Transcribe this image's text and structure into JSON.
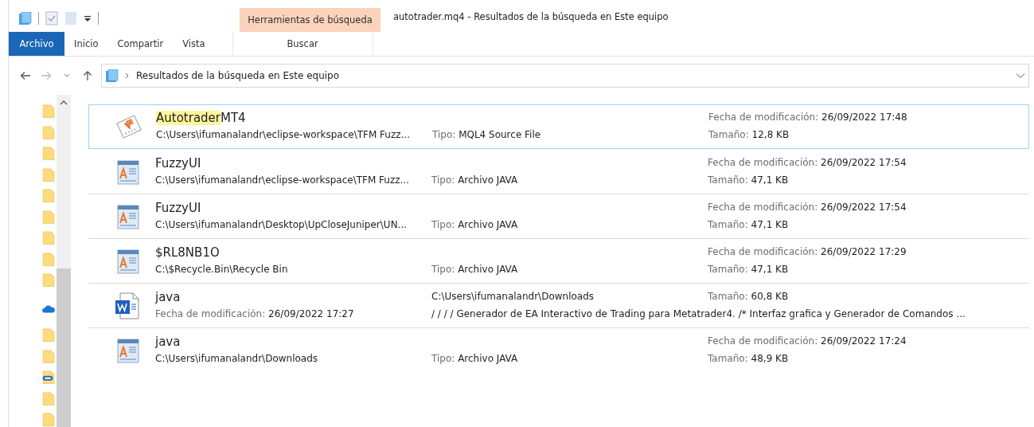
{
  "window": {
    "title": "autotrader.mq4 - Resultados de la búsqueda en Este equipo"
  },
  "contextual_group": {
    "label": "Herramientas de búsqueda"
  },
  "tabs": [
    {
      "label": "Archivo",
      "kind": "file",
      "selected": false
    },
    {
      "label": "Inicio",
      "kind": "tab",
      "selected": false
    },
    {
      "label": "Compartir",
      "kind": "tab",
      "selected": false
    },
    {
      "label": "Vista",
      "kind": "tab",
      "selected": false
    },
    {
      "label": "Buscar",
      "kind": "contextual",
      "selected": false
    }
  ],
  "address_bar": {
    "location": "Resultados de la búsqueda en Este equipo"
  },
  "nav_items": [
    {
      "kind": "folder"
    },
    {
      "kind": "folder"
    },
    {
      "kind": "folder"
    },
    {
      "kind": "folder"
    },
    {
      "kind": "folder"
    },
    {
      "kind": "folder"
    },
    {
      "kind": "folder"
    },
    {
      "kind": "folder"
    },
    {
      "kind": "folder"
    },
    {
      "kind": "cloud"
    },
    {
      "kind": "folder"
    },
    {
      "kind": "folder"
    },
    {
      "kind": "link"
    },
    {
      "kind": "folder"
    },
    {
      "kind": "folder"
    }
  ],
  "results": [
    {
      "kind": "script",
      "selected": true,
      "name_parts": [
        {
          "text": "Autotrader",
          "highlight": true
        },
        {
          "text": "MT4",
          "highlight": false
        }
      ],
      "path": "C:\\Users\\ifumanalandr\\eclipse-workspace\\TFM Fuzz...",
      "type": {
        "label": "Tipo:",
        "value": "MQL4 Source File"
      },
      "modified": {
        "label": "Fecha de modificación:",
        "value": "26/09/2022 17:48"
      },
      "size": {
        "label": "Tamaño:",
        "value": "12,8 KB"
      }
    },
    {
      "kind": "text",
      "selected": false,
      "name_parts": [
        {
          "text": "FuzzyUI",
          "highlight": false
        }
      ],
      "path": "C:\\Users\\ifumanalandr\\eclipse-workspace\\TFM Fuzz...",
      "type": {
        "label": "Tipo:",
        "value": "Archivo JAVA"
      },
      "modified": {
        "label": "Fecha de modificación:",
        "value": "26/09/2022 17:54"
      },
      "size": {
        "label": "Tamaño:",
        "value": "47,1 KB"
      }
    },
    {
      "kind": "text",
      "selected": false,
      "name_parts": [
        {
          "text": "FuzzyUI",
          "highlight": false
        }
      ],
      "path": "C:\\Users\\ifumanalandr\\Desktop\\UpCloseJuniper\\UN...",
      "type": {
        "label": "Tipo:",
        "value": "Archivo JAVA"
      },
      "modified": {
        "label": "Fecha de modificación:",
        "value": "26/09/2022 17:54"
      },
      "size": {
        "label": "Tamaño:",
        "value": "47,1 KB"
      }
    },
    {
      "kind": "text",
      "selected": false,
      "name_parts": [
        {
          "text": "$RL8NB1O",
          "highlight": false
        }
      ],
      "path": "C:\\$Recycle.Bin\\Recycle Bin",
      "type": {
        "label": "Tipo:",
        "value": "Archivo JAVA"
      },
      "modified": {
        "label": "Fecha de modificación:",
        "value": "26/09/2022 17:29"
      },
      "size": {
        "label": "Tamaño:",
        "value": "47,1 KB"
      }
    },
    {
      "kind": "document",
      "selected": false,
      "name_parts": [
        {
          "text": "java",
          "highlight": false
        }
      ],
      "modified": {
        "label": "Fecha de modificación:",
        "value": "26/09/2022 17:27"
      },
      "path": "C:\\Users\\ifumanalandr\\Downloads",
      "size": {
        "label": "Tamaño:",
        "value": "60,8 KB"
      },
      "snippet": "/ / / / Generador de EA Interactivo de Trading para Metatrader4. /* Interfaz grafica y Generador de Comandos ..."
    },
    {
      "kind": "text",
      "selected": false,
      "name_parts": [
        {
          "text": "java",
          "highlight": false
        }
      ],
      "path": "C:\\Users\\ifumanalandr\\Downloads",
      "type": {
        "label": "Tipo:",
        "value": "Archivo JAVA"
      },
      "modified": {
        "label": "Fecha de modificación:",
        "value": "26/09/2022 17:24"
      },
      "size": {
        "label": "Tamaño:",
        "value": "48,9 KB"
      }
    }
  ]
}
